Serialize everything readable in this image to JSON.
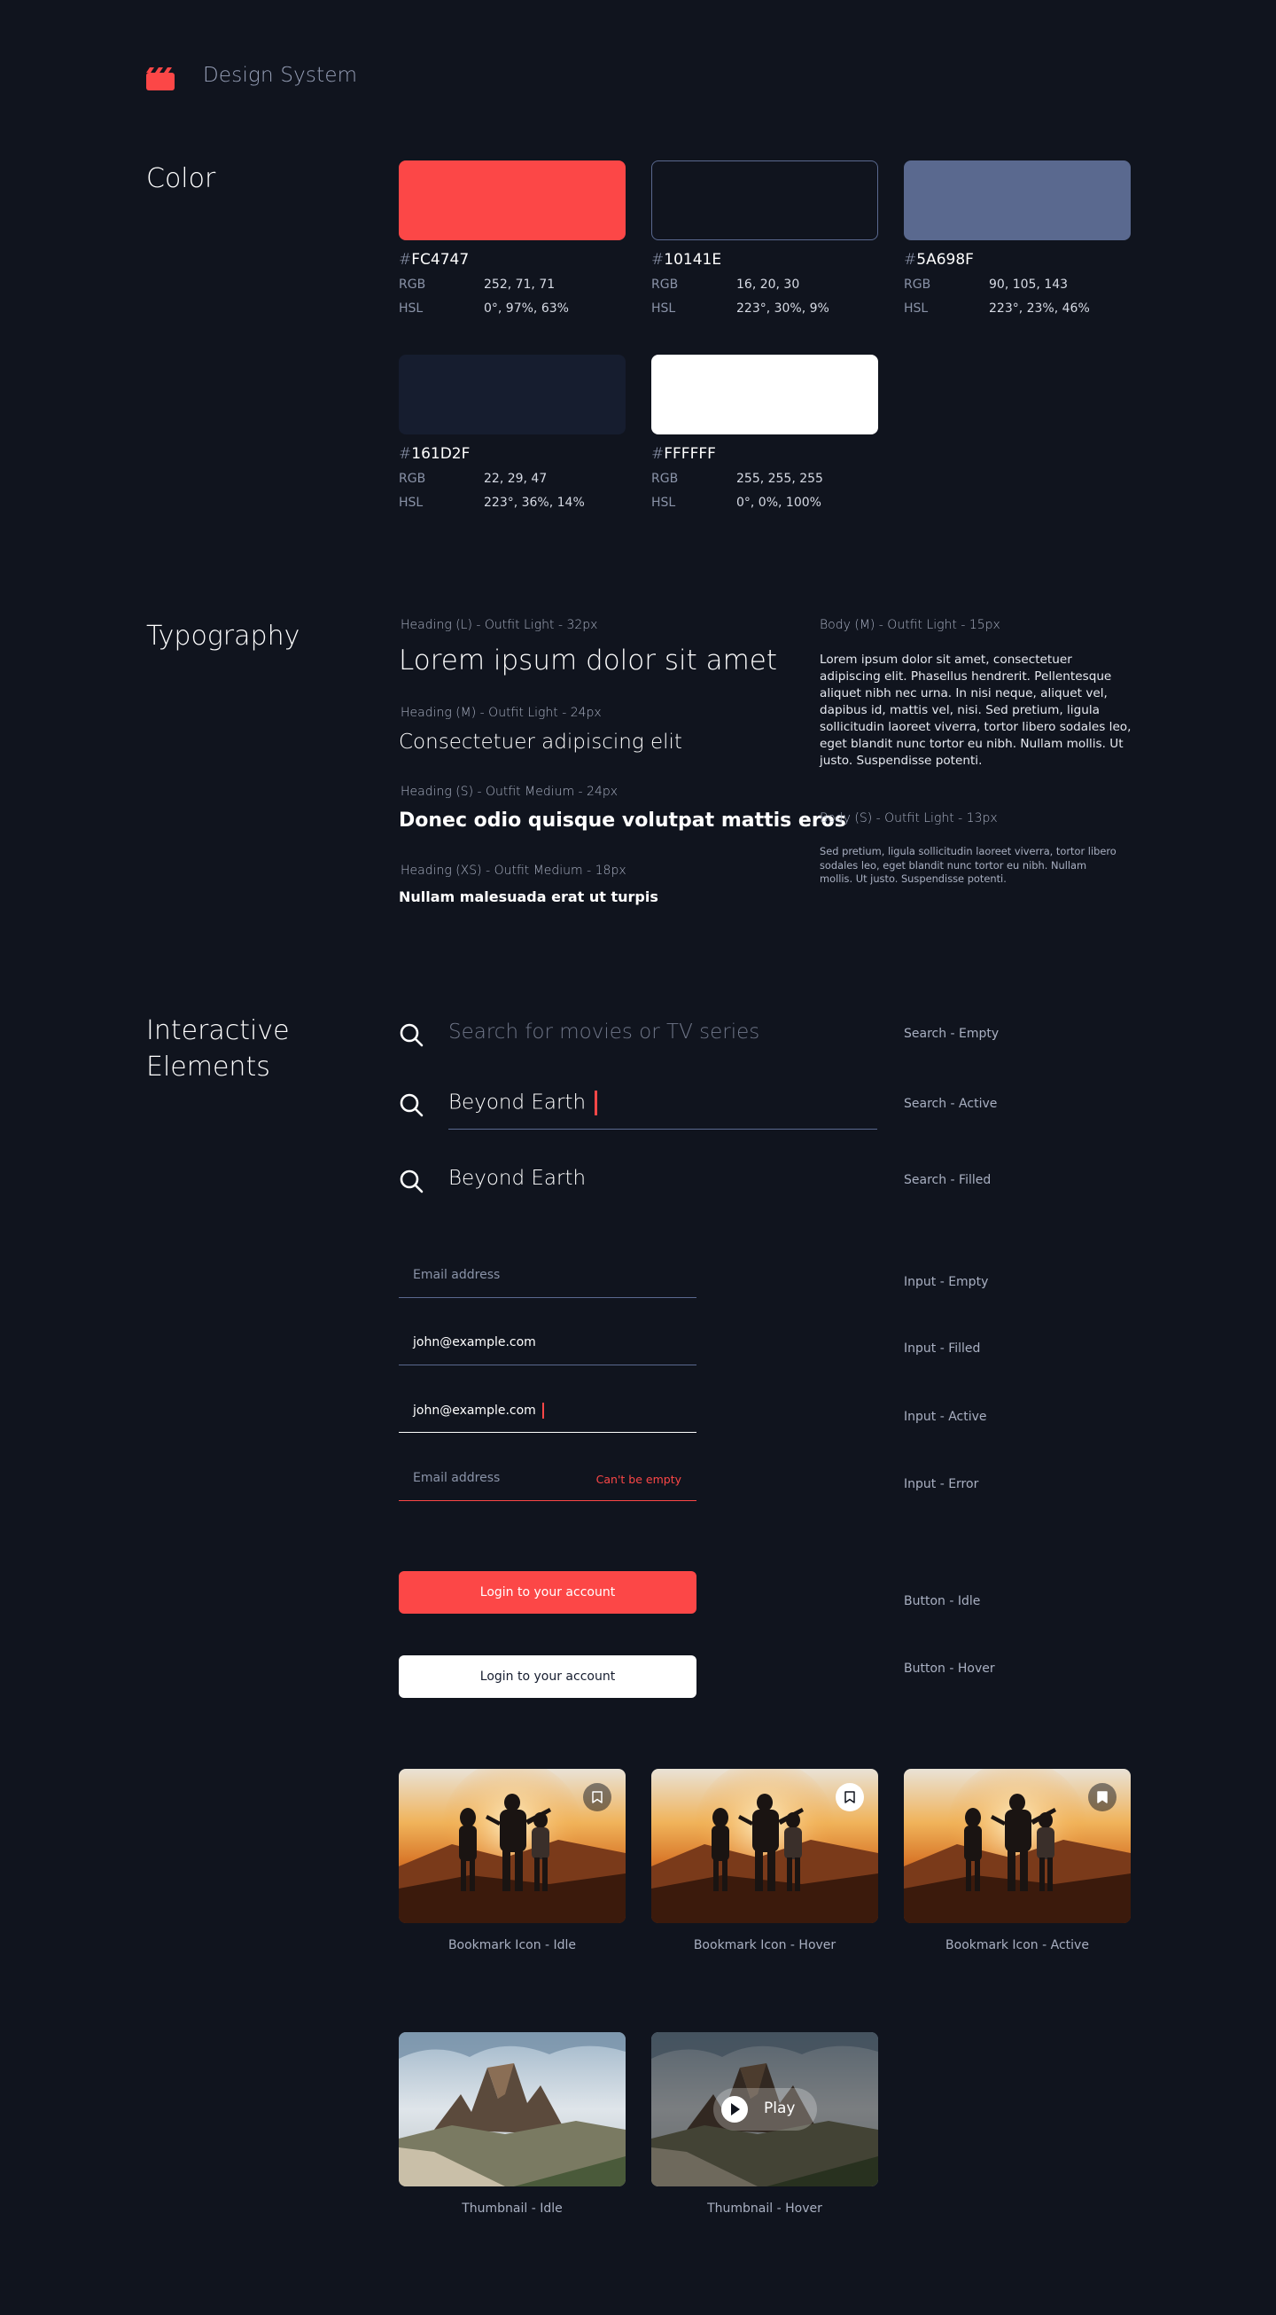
{
  "header": {
    "brand": "Design System"
  },
  "sections": {
    "color": "Color",
    "typography": "Typography",
    "interactive": [
      "Interactive",
      "Elements"
    ]
  },
  "colors": [
    {
      "hash": "#",
      "code": "FC4747",
      "rgb_label": "RGB",
      "rgb": "252, 71, 71",
      "hsl_label": "HSL",
      "hsl": "0°, 97%, 63%",
      "swatch": "#FC4747"
    },
    {
      "hash": "#",
      "code": "10141E",
      "rgb_label": "RGB",
      "rgb": "16, 20, 30",
      "hsl_label": "HSL",
      "hsl": "223°, 30%, 9%",
      "swatch": "#10141E"
    },
    {
      "hash": "#",
      "code": "5A698F",
      "rgb_label": "RGB",
      "rgb": "90, 105, 143",
      "hsl_label": "HSL",
      "hsl": "223°, 23%, 46%",
      "swatch": "#5A698F"
    },
    {
      "hash": "#",
      "code": "161D2F",
      "rgb_label": "RGB",
      "rgb": "22, 29, 47",
      "hsl_label": "HSL",
      "hsl": "223°, 36%, 14%",
      "swatch": "#161D2F"
    },
    {
      "hash": "#",
      "code": "FFFFFF",
      "rgb_label": "RGB",
      "rgb": "255, 255, 255",
      "hsl_label": "HSL",
      "hsl": "0°, 0%, 100%",
      "swatch": "#FFFFFF"
    }
  ],
  "typography": {
    "heading_l": {
      "label": "Heading (L) - Outfit Light - 32px",
      "sample": "Lorem ipsum dolor sit amet"
    },
    "heading_m": {
      "label": "Heading (M) - Outfit Light - 24px",
      "sample": "Consectetuer adipiscing elit"
    },
    "heading_s": {
      "label": "Heading (S) - Outfit Medium - 24px",
      "sample": "Donec odio quisque volutpat mattis eros"
    },
    "heading_xs": {
      "label": "Heading (XS) - Outfit Medium - 18px",
      "sample": "Nullam malesuada erat ut turpis"
    },
    "body_m": {
      "label": "Body (M) - Outfit Light - 15px",
      "sample": "Lorem ipsum dolor sit amet, consectetuer adipiscing elit. Phasellus hendrerit. Pellentesque aliquet nibh nec urna. In nisi neque, aliquet vel, dapibus id, mattis vel, nisi. Sed pretium, ligula sollicitudin laoreet viverra, tortor libero sodales leo, eget blandit nunc tortor eu nibh. Nullam mollis. Ut justo. Suspendisse potenti."
    },
    "body_s": {
      "label": "Body (S) - Outfit Light - 13px",
      "sample": "Sed pretium, ligula sollicitudin laoreet viverra, tortor libero sodales leo, eget blandit nunc tortor eu nibh. Nullam mollis. Ut justo. Suspendisse potenti."
    }
  },
  "search": {
    "empty": {
      "placeholder": "Search for movies or TV series",
      "state": "Search - Empty"
    },
    "active": {
      "value": "Beyond Earth",
      "state": "Search - Active"
    },
    "filled": {
      "value": "Beyond Earth",
      "state": "Search - Filled"
    }
  },
  "inputs": {
    "empty": {
      "placeholder": "Email address",
      "state": "Input - Empty"
    },
    "filled": {
      "value": "john@example.com",
      "state": "Input - Filled"
    },
    "active": {
      "value": "john@example.com",
      "state": "Input - Active"
    },
    "error": {
      "placeholder": "Email address",
      "error": "Can't be empty",
      "state": "Input - Error"
    }
  },
  "buttons": {
    "idle": {
      "label": "Login to your account",
      "state": "Button - Idle"
    },
    "hover": {
      "label": "Login to your account",
      "state": "Button - Hover"
    }
  },
  "cards": {
    "bookmark_idle": "Bookmark Icon - Idle",
    "bookmark_hover": "Bookmark Icon - Hover",
    "bookmark_active": "Bookmark Icon - Active",
    "thumb_idle": "Thumbnail - Idle",
    "thumb_hover": "Thumbnail - Hover",
    "play_label": "Play"
  }
}
